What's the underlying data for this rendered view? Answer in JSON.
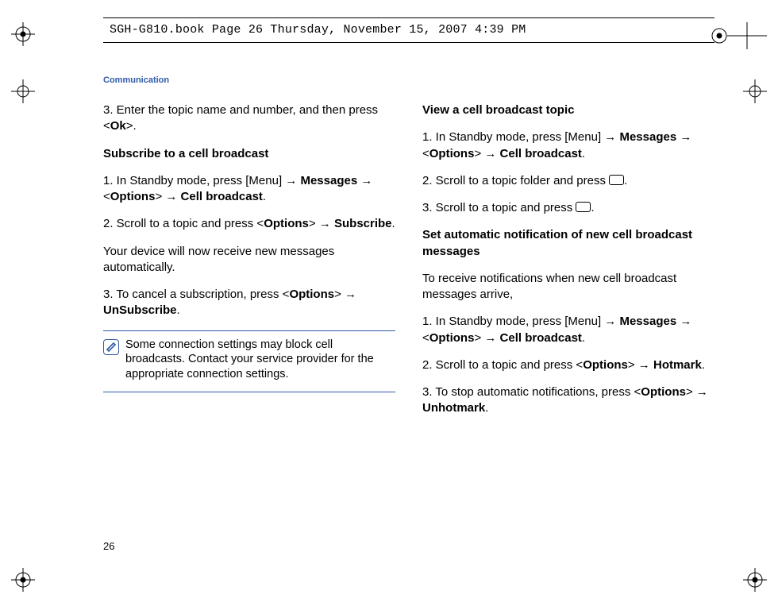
{
  "doc_meta": "SGH-G810.book  Page 26  Thursday, November 15, 2007  4:39 PM",
  "section_label": "Communication",
  "page_number": "26",
  "left": {
    "step3_pre": "3. Enter the topic name and number, and then press <",
    "step3_bold": "Ok",
    "step3_post": ">.",
    "h_subscribe": "Subscribe to a cell broadcast",
    "s1_a": "1. In Standby mode, press [Menu] → ",
    "s1_b": "Messages",
    "s1_c": " → <",
    "s1_d": "Options",
    "s1_e": "> → ",
    "s1_f": "Cell broadcast",
    "s1_g": ".",
    "s2_a": "2. Scroll to a topic and press <",
    "s2_b": "Options",
    "s2_c": "> → ",
    "s2_d": "Subscribe",
    "s2_e": ".",
    "s2_body": "Your device will now receive new messages automatically.",
    "s3_a": "3. To cancel a subscription, press <",
    "s3_b": "Options",
    "s3_c": "> → ",
    "s3_d": "UnSubscribe",
    "s3_e": ".",
    "note": "Some connection settings may block cell broadcasts. Contact your service provider for the appropriate connection settings."
  },
  "right": {
    "h_view": "View a cell broadcast topic",
    "v1_a": "1. In Standby mode, press [Menu] → ",
    "v1_b": "Messages",
    "v1_c": " → <",
    "v1_d": "Options",
    "v1_e": "> → ",
    "v1_f": "Cell broadcast",
    "v1_g": ".",
    "v2_a": "2. Scroll to a topic folder and press ",
    "v2_b": ".",
    "v3_a": "3. Scroll to a topic and press ",
    "v3_b": ".",
    "h_auto": "Set automatic notification of new cell broadcast messages",
    "auto_intro": "To receive notifications when new cell broadcast messages arrive,",
    "a1_a": "1. In Standby mode, press [Menu] → ",
    "a1_b": "Messages",
    "a1_c": " → <",
    "a1_d": "Options",
    "a1_e": "> → ",
    "a1_f": "Cell broadcast",
    "a1_g": ".",
    "a2_a": "2. Scroll to a topic and press <",
    "a2_b": "Options",
    "a2_c": "> → ",
    "a2_d": "Hotmark",
    "a2_e": ".",
    "a3_a": "3. To stop automatic notifications, press <",
    "a3_b": "Options",
    "a3_c": "> → ",
    "a3_d": "Unhotmark",
    "a3_e": "."
  }
}
